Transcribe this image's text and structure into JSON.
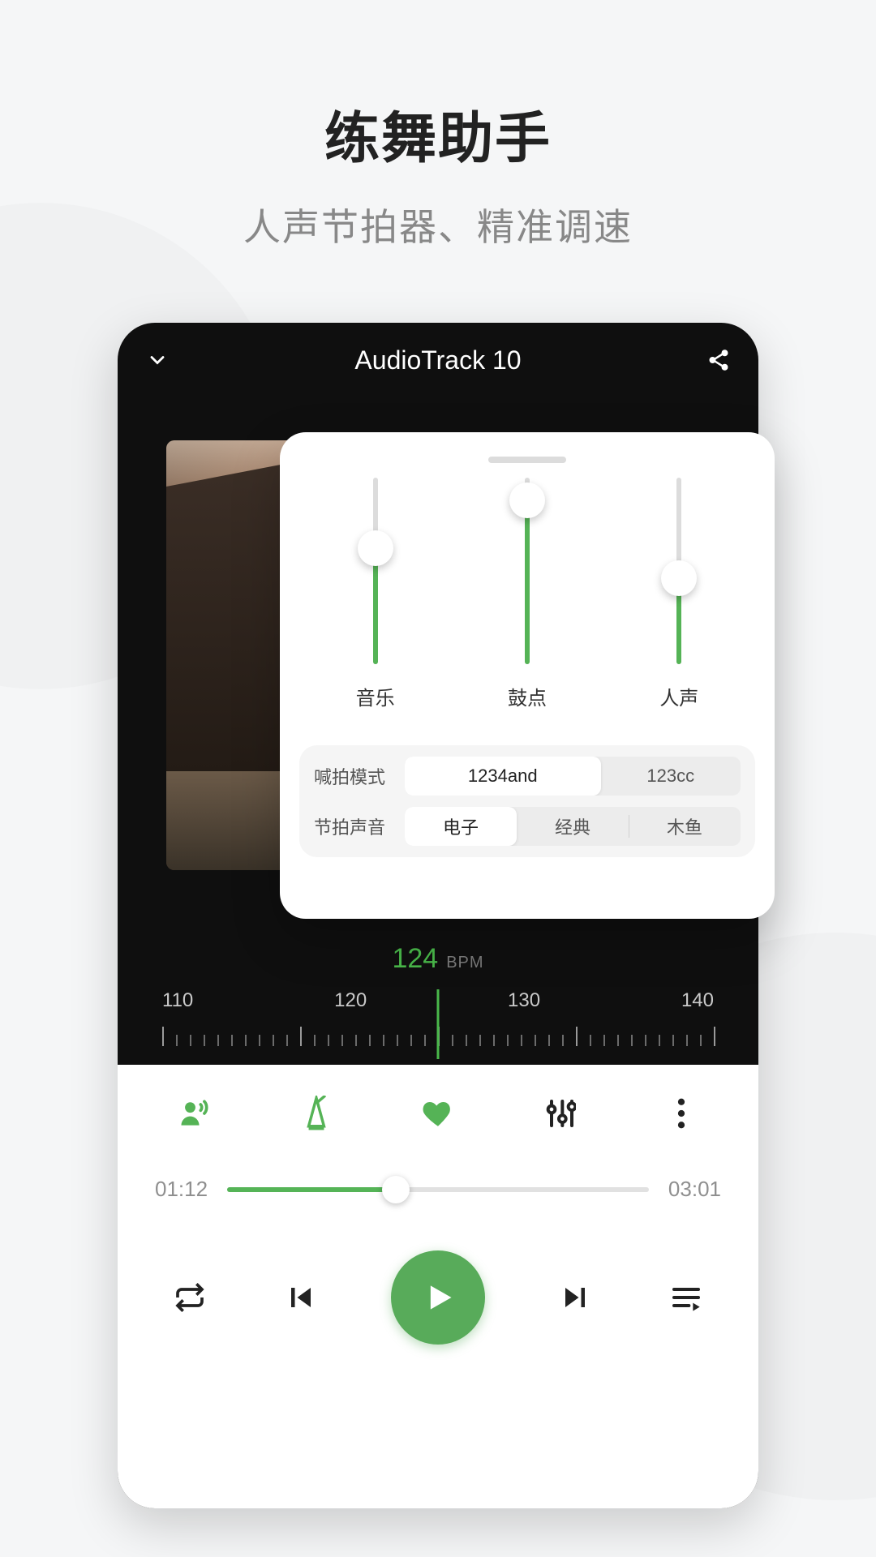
{
  "hero": {
    "title": "练舞助手",
    "subtitle": "人声节拍器、精准调速"
  },
  "player": {
    "track_title": "AudioTrack 10",
    "bpm": {
      "value": "124",
      "unit": "BPM"
    },
    "ruler_labels": [
      "110",
      "120",
      "130",
      "140"
    ],
    "progress": {
      "elapsed": "01:12",
      "total": "03:01",
      "percent": 40
    }
  },
  "popup": {
    "sliders": [
      {
        "label": "音乐",
        "percent": 62
      },
      {
        "label": "鼓点",
        "percent": 88
      },
      {
        "label": "人声",
        "percent": 46
      }
    ],
    "mode": {
      "label": "喊拍模式",
      "options": [
        "1234and",
        "123cc"
      ],
      "selected": 0
    },
    "sound": {
      "label": "节拍声音",
      "options": [
        "电子",
        "经典",
        "木鱼"
      ],
      "selected": 0
    }
  },
  "colors": {
    "accent": "#55b356"
  }
}
